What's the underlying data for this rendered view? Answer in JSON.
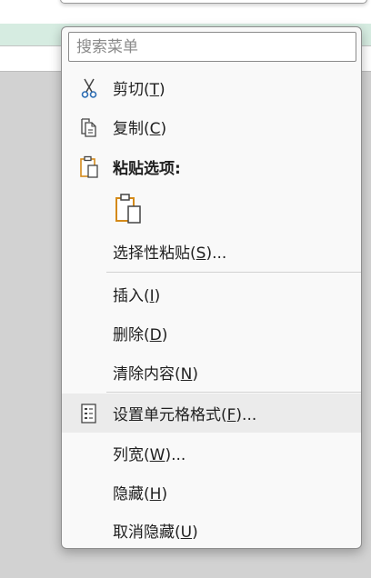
{
  "menu": {
    "search_placeholder": "搜索菜单",
    "items": {
      "cut": {
        "label": "剪切(",
        "key": "T",
        "end": ")"
      },
      "copy": {
        "label": "复制(",
        "key": "C",
        "end": ")"
      },
      "paste_options": {
        "label": "粘贴选项:"
      },
      "paste_special": {
        "label": "选择性粘贴(",
        "key": "S",
        "end": ")..."
      },
      "insert": {
        "label": "插入(",
        "key": "I",
        "end": ")"
      },
      "delete": {
        "label": "删除(",
        "key": "D",
        "end": ")"
      },
      "clear_contents": {
        "label": "清除内容(",
        "key": "N",
        "end": ")"
      },
      "format_cells": {
        "label": "设置单元格格式(",
        "key": "F",
        "end": ")..."
      },
      "column_width": {
        "label": "列宽(",
        "key": "W",
        "end": ")..."
      },
      "hide": {
        "label": "隐藏(",
        "key": "H",
        "end": ")"
      },
      "unhide": {
        "label": "取消隐藏(",
        "key": "U",
        "end": ")"
      }
    },
    "icons": {
      "cut": "scissors-icon",
      "copy": "copy-icon",
      "paste_options": "clipboard-icon",
      "paste_option_1": "paste-clipboard-icon",
      "format_cells": "format-cells-icon"
    }
  },
  "colors": {
    "menu_bg": "#f9f9f9",
    "hover_bg": "#ebebeb",
    "accent_blue": "#2f6fb5",
    "accent_orange": "#d48a1a",
    "header_band": "#d6ece1"
  }
}
